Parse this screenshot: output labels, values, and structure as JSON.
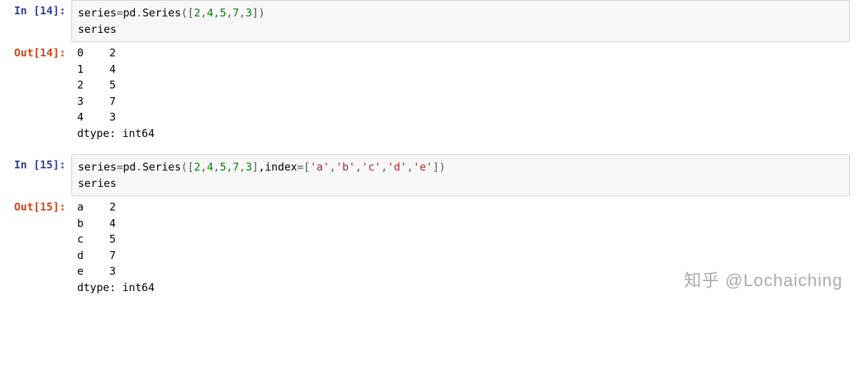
{
  "cells": [
    {
      "exec": 14,
      "in_prompt": "In [14]:",
      "code_line1": {
        "var": "series",
        "assign": "=",
        "mod": "pd",
        "dot": ".",
        "cls": "Series",
        "open": "(",
        "br_open": "[",
        "nums": [
          "2",
          "4",
          "5",
          "7",
          "3"
        ],
        "commas": [
          ",",
          ",",
          ",",
          ","
        ],
        "br_close": "]",
        "close": ")"
      },
      "code_line2": "series",
      "out_prompt": "Out[14]:",
      "out_idx": [
        "0",
        "1",
        "2",
        "3",
        "4"
      ],
      "out_val": [
        "2",
        "4",
        "5",
        "7",
        "3"
      ],
      "dtype": "dtype: int64"
    },
    {
      "exec": 15,
      "in_prompt": "In [15]:",
      "code_line1": {
        "var": "series",
        "assign": "=",
        "mod": "pd",
        "dot": ".",
        "cls": "Series",
        "open": "(",
        "br_open": "[",
        "nums": [
          "2",
          "4",
          "5",
          "7",
          "3"
        ],
        "commas": [
          ",",
          ",",
          ",",
          ","
        ],
        "br_close": "]",
        "kwarg": ",index",
        "kwassign": "=",
        "idx_br_open": "[",
        "strs": [
          "'a'",
          "'b'",
          "'c'",
          "'d'",
          "'e'"
        ],
        "scommas": [
          ",",
          ",",
          ",",
          ","
        ],
        "idx_br_close": "]",
        "close": ")"
      },
      "code_line2": "series",
      "out_prompt": "Out[15]:",
      "out_idx": [
        "a",
        "b",
        "c",
        "d",
        "e"
      ],
      "out_val": [
        "2",
        "4",
        "5",
        "7",
        "3"
      ],
      "dtype": "dtype: int64"
    }
  ],
  "watermark": "知乎 @Lochaiching"
}
